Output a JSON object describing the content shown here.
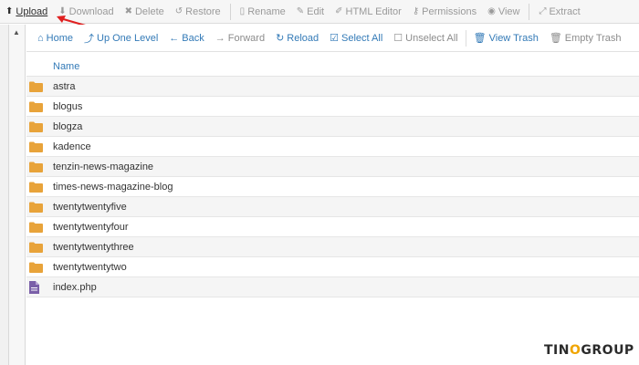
{
  "toolbar": {
    "items": [
      {
        "label": "Upload",
        "icon": "upload-icon",
        "glyph": "⬆",
        "active": true
      },
      {
        "label": "Download",
        "icon": "download-icon",
        "glyph": "⬇",
        "active": false
      },
      {
        "label": "Delete",
        "icon": "close-icon",
        "glyph": "✖",
        "active": false
      },
      {
        "label": "Restore",
        "icon": "restore-icon",
        "glyph": "↺",
        "active": false
      },
      {
        "label": "Rename",
        "icon": "rename-icon",
        "glyph": "▯",
        "active": false
      },
      {
        "label": "Edit",
        "icon": "pencil-icon",
        "glyph": "✎",
        "active": false
      },
      {
        "label": "HTML Editor",
        "icon": "html-editor-icon",
        "glyph": "✐",
        "active": false
      },
      {
        "label": "Permissions",
        "icon": "key-icon",
        "glyph": "⚷",
        "active": false
      },
      {
        "label": "View",
        "icon": "eye-icon",
        "glyph": "◉",
        "active": false
      },
      {
        "label": "Extract",
        "icon": "expand-icon",
        "glyph": "⤢",
        "active": false
      }
    ]
  },
  "nav": {
    "items": [
      {
        "label": "Home",
        "icon": "home-icon",
        "glyph": "⌂",
        "disabled": false
      },
      {
        "label": "Up One Level",
        "icon": "level-up-icon",
        "glyph": "⤴",
        "disabled": false
      },
      {
        "label": "Back",
        "icon": "arrow-left-icon",
        "glyph": "←",
        "disabled": false
      },
      {
        "label": "Forward",
        "icon": "arrow-right-icon",
        "glyph": "→",
        "disabled": true
      },
      {
        "label": "Reload",
        "icon": "reload-icon",
        "glyph": "↻",
        "disabled": false
      },
      {
        "label": "Select All",
        "icon": "checkbox-checked-icon",
        "glyph": "☑",
        "disabled": false
      },
      {
        "label": "Unselect All",
        "icon": "checkbox-empty-icon",
        "glyph": "☐",
        "disabled": true
      },
      {
        "label": "View Trash",
        "icon": "trash-icon",
        "glyph": "🗑",
        "disabled": false
      },
      {
        "label": "Empty Trash",
        "icon": "trash-icon",
        "glyph": "🗑",
        "disabled": true
      }
    ]
  },
  "table": {
    "header": "Name",
    "rows": [
      {
        "name": "astra",
        "type": "folder"
      },
      {
        "name": "blogus",
        "type": "folder"
      },
      {
        "name": "blogza",
        "type": "folder"
      },
      {
        "name": "kadence",
        "type": "folder"
      },
      {
        "name": "tenzin-news-magazine",
        "type": "folder"
      },
      {
        "name": "times-news-magazine-blog",
        "type": "folder"
      },
      {
        "name": "twentytwentyfive",
        "type": "folder"
      },
      {
        "name": "twentytwentyfour",
        "type": "folder"
      },
      {
        "name": "twentytwentythree",
        "type": "folder"
      },
      {
        "name": "twentytwentytwo",
        "type": "folder"
      },
      {
        "name": "index.php",
        "type": "file"
      }
    ]
  },
  "brand": {
    "part1": "TIN",
    "part2": "O",
    "part3": "GROUP"
  },
  "colors": {
    "link": "#337ab7",
    "folder": "#e8a33a",
    "file": "#7a5fa8",
    "annotation": "#e02020",
    "brand_accent": "#f0a500"
  }
}
